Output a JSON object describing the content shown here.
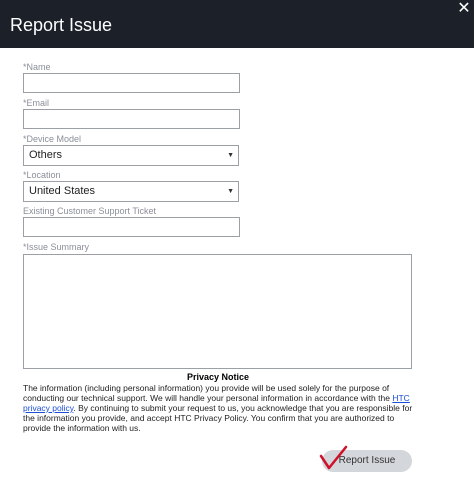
{
  "dialog": {
    "title": "Report Issue",
    "close_icon": "close-icon"
  },
  "form": {
    "name_label": "*Name",
    "name_value": "",
    "email_label": "*Email",
    "email_value": "",
    "device_label": "*Device Model",
    "device_value": "Others",
    "location_label": "*Location",
    "location_value": "United States",
    "ticket_label": "Existing Customer Support Ticket",
    "ticket_value": "",
    "summary_label": "*Issue Summary",
    "summary_value": ""
  },
  "privacy": {
    "title": "Privacy Notice",
    "text_before": "The information (including personal information) you provide will be used solely for the purpose of conducting our technical support. We will handle your personal information in accordance with the ",
    "link": "HTC privacy policy",
    "text_after": ". By continuing to submit your request to us, you acknowledge that you are responsible for the information you provide, and accept HTC Privacy Policy. You confirm that you are authorized to provide the information with us."
  },
  "submit": {
    "label": "Report Issue",
    "check_color": "#d0102a"
  },
  "colors": {
    "header_bg": "#1b2029",
    "link": "#1a4fd6"
  }
}
